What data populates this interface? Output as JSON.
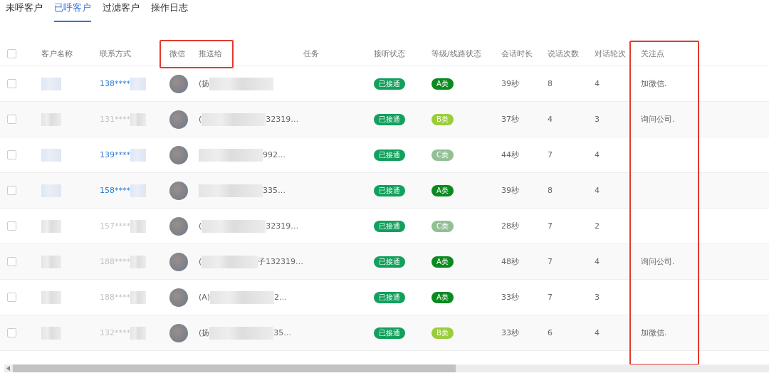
{
  "tabs": [
    {
      "label": "未呼客户",
      "selected": false
    },
    {
      "label": "已呼客户",
      "selected": true
    },
    {
      "label": "过滤客户",
      "selected": false
    },
    {
      "label": "操作日志",
      "selected": false
    }
  ],
  "table": {
    "columns": [
      "客户名称",
      "联系方式",
      "微信",
      "推送给",
      "任务",
      "接听状态",
      "等级/线路状态",
      "会话时长",
      "说话次数",
      "对话轮次",
      "关注点"
    ],
    "header_checked": false,
    "rows": [
      {
        "checked": false,
        "dimmed": false,
        "phone": "138****",
        "push_prefix": "(扬",
        "push_suffix": "",
        "status": "已接通",
        "grade": "A类",
        "color": "#0a8a1e",
        "duration": "39秒",
        "talks": "8",
        "rounds": "4",
        "focus": "加微信."
      },
      {
        "checked": false,
        "dimmed": true,
        "phone": "131****",
        "push_prefix": "(",
        "push_suffix": "32319…",
        "status": "已接通",
        "grade": "B类",
        "color": "#9acd3a",
        "duration": "37秒",
        "talks": "4",
        "rounds": "3",
        "focus": "询问公司."
      },
      {
        "checked": false,
        "dimmed": false,
        "phone": "139****",
        "push_prefix": "",
        "push_suffix": "992…",
        "status": "已接通",
        "grade": "C类",
        "color": "#93bf95",
        "duration": "44秒",
        "talks": "7",
        "rounds": "4",
        "focus": ""
      },
      {
        "checked": false,
        "dimmed": false,
        "phone": "158****",
        "push_prefix": "",
        "push_suffix": "335…",
        "status": "已接通",
        "grade": "A类",
        "color": "#0a8a1e",
        "duration": "39秒",
        "talks": "8",
        "rounds": "4",
        "focus": ""
      },
      {
        "checked": false,
        "dimmed": true,
        "phone": "157****",
        "push_prefix": "(",
        "push_suffix": "32319…",
        "status": "已接通",
        "grade": "C类",
        "color": "#93bf95",
        "duration": "28秒",
        "talks": "7",
        "rounds": "2",
        "focus": ""
      },
      {
        "checked": false,
        "dimmed": true,
        "phone": "188****",
        "push_prefix": "(",
        "push_suffix": "子132319…",
        "status": "已接通",
        "grade": "A类",
        "color": "#0a8a1e",
        "duration": "48秒",
        "talks": "7",
        "rounds": "4",
        "focus": "询问公司."
      },
      {
        "checked": false,
        "dimmed": true,
        "phone": "188****",
        "push_prefix": "(A)",
        "push_suffix": "2…",
        "status": "已接通",
        "grade": "A类",
        "color": "#0a8a1e",
        "duration": "33秒",
        "talks": "7",
        "rounds": "3",
        "focus": ""
      },
      {
        "checked": false,
        "dimmed": true,
        "phone": "132****",
        "push_prefix": "(扬",
        "push_suffix": "35…",
        "status": "已接通",
        "grade": "B类",
        "color": "#9acd3a",
        "duration": "33秒",
        "talks": "6",
        "rounds": "4",
        "focus": "加微信."
      }
    ]
  }
}
